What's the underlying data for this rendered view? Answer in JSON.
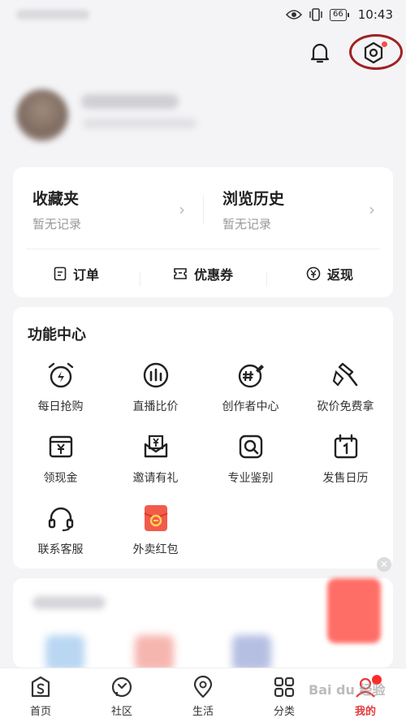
{
  "status_bar": {
    "time": "10:43",
    "battery": "66"
  },
  "cards": {
    "favorites": {
      "title": "收藏夹",
      "subtitle": "暂无记录"
    },
    "history": {
      "title": "浏览历史",
      "subtitle": "暂无记录"
    }
  },
  "tools": [
    {
      "label": "订单",
      "icon": "order-icon"
    },
    {
      "label": "优惠券",
      "icon": "coupon-icon"
    },
    {
      "label": "返现",
      "icon": "cashback-icon"
    }
  ],
  "function_center": {
    "title": "功能中心",
    "items": [
      {
        "label": "每日抢购",
        "icon": "alarm-clock-icon"
      },
      {
        "label": "直播比价",
        "icon": "live-chart-icon"
      },
      {
        "label": "创作者中心",
        "icon": "creator-icon"
      },
      {
        "label": "砍价免费拿",
        "icon": "axe-icon"
      },
      {
        "label": "领现金",
        "icon": "cash-icon"
      },
      {
        "label": "邀请有礼",
        "icon": "gift-envelope-icon"
      },
      {
        "label": "专业鉴别",
        "icon": "appraisal-icon"
      },
      {
        "label": "发售日历",
        "icon": "calendar-icon"
      },
      {
        "label": "联系客服",
        "icon": "headset-icon"
      },
      {
        "label": "外卖红包",
        "icon": "red-packet-icon"
      }
    ]
  },
  "tabbar": [
    {
      "label": "首页",
      "icon": "home-icon"
    },
    {
      "label": "社区",
      "icon": "community-icon"
    },
    {
      "label": "生活",
      "icon": "location-icon"
    },
    {
      "label": "分类",
      "icon": "category-icon"
    },
    {
      "label": "我的",
      "icon": "profile-icon"
    }
  ],
  "watermark": "Bai du 经验",
  "colors": {
    "accent": "#e43b3b",
    "highlight_circle": "#a02222"
  }
}
